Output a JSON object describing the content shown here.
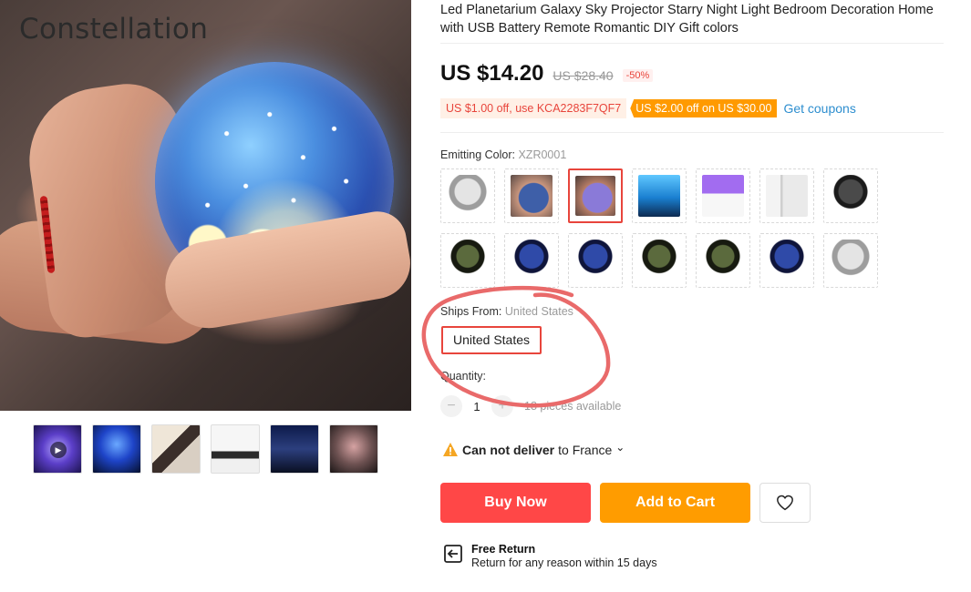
{
  "gallery": {
    "brand_text": "Constellation",
    "thumbnails": [
      "video",
      "projection-blue",
      "product-collage",
      "accessories",
      "product-light-display",
      "hand-orb"
    ],
    "play_icon": "play-icon"
  },
  "product": {
    "title": "Led Planetarium Galaxy Sky Projector Starry Night Light Bedroom Decoration Home with USB Battery Remote Romantic DIY Gift colors",
    "price": "US $14.20",
    "original_price": "US $28.40",
    "discount": "-50%",
    "coupon_code_text": "US $1.00 off, use KCA2283F7QF7",
    "coupon_store_text": "US $2.00 off on US $30.00",
    "coupon_link": "Get coupons"
  },
  "color": {
    "label": "Emitting Color:",
    "selected": "XZR0001"
  },
  "shipping": {
    "label": "Ships From:",
    "selected": "United States",
    "option": "United States"
  },
  "quantity": {
    "label": "Quantity:",
    "value": "1",
    "minus": "−",
    "plus": "+",
    "available": "18 pieces available"
  },
  "delivery": {
    "warning_strong": "Can not deliver",
    "warning_rest": "to France",
    "chevron": "⌄"
  },
  "actions": {
    "buy_now": "Buy Now",
    "add_to_cart": "Add to Cart",
    "wishlist_icon": "heart-icon"
  },
  "returns": {
    "title": "Free Return",
    "subtitle": "Return for any reason within 15 days"
  },
  "colors": {
    "price_red": "#e8453c",
    "buy_now_bg": "#ff4747",
    "add_to_cart_bg": "#ff9c00",
    "link_blue": "#2d8ecf",
    "annotation": "#e96a6a"
  }
}
